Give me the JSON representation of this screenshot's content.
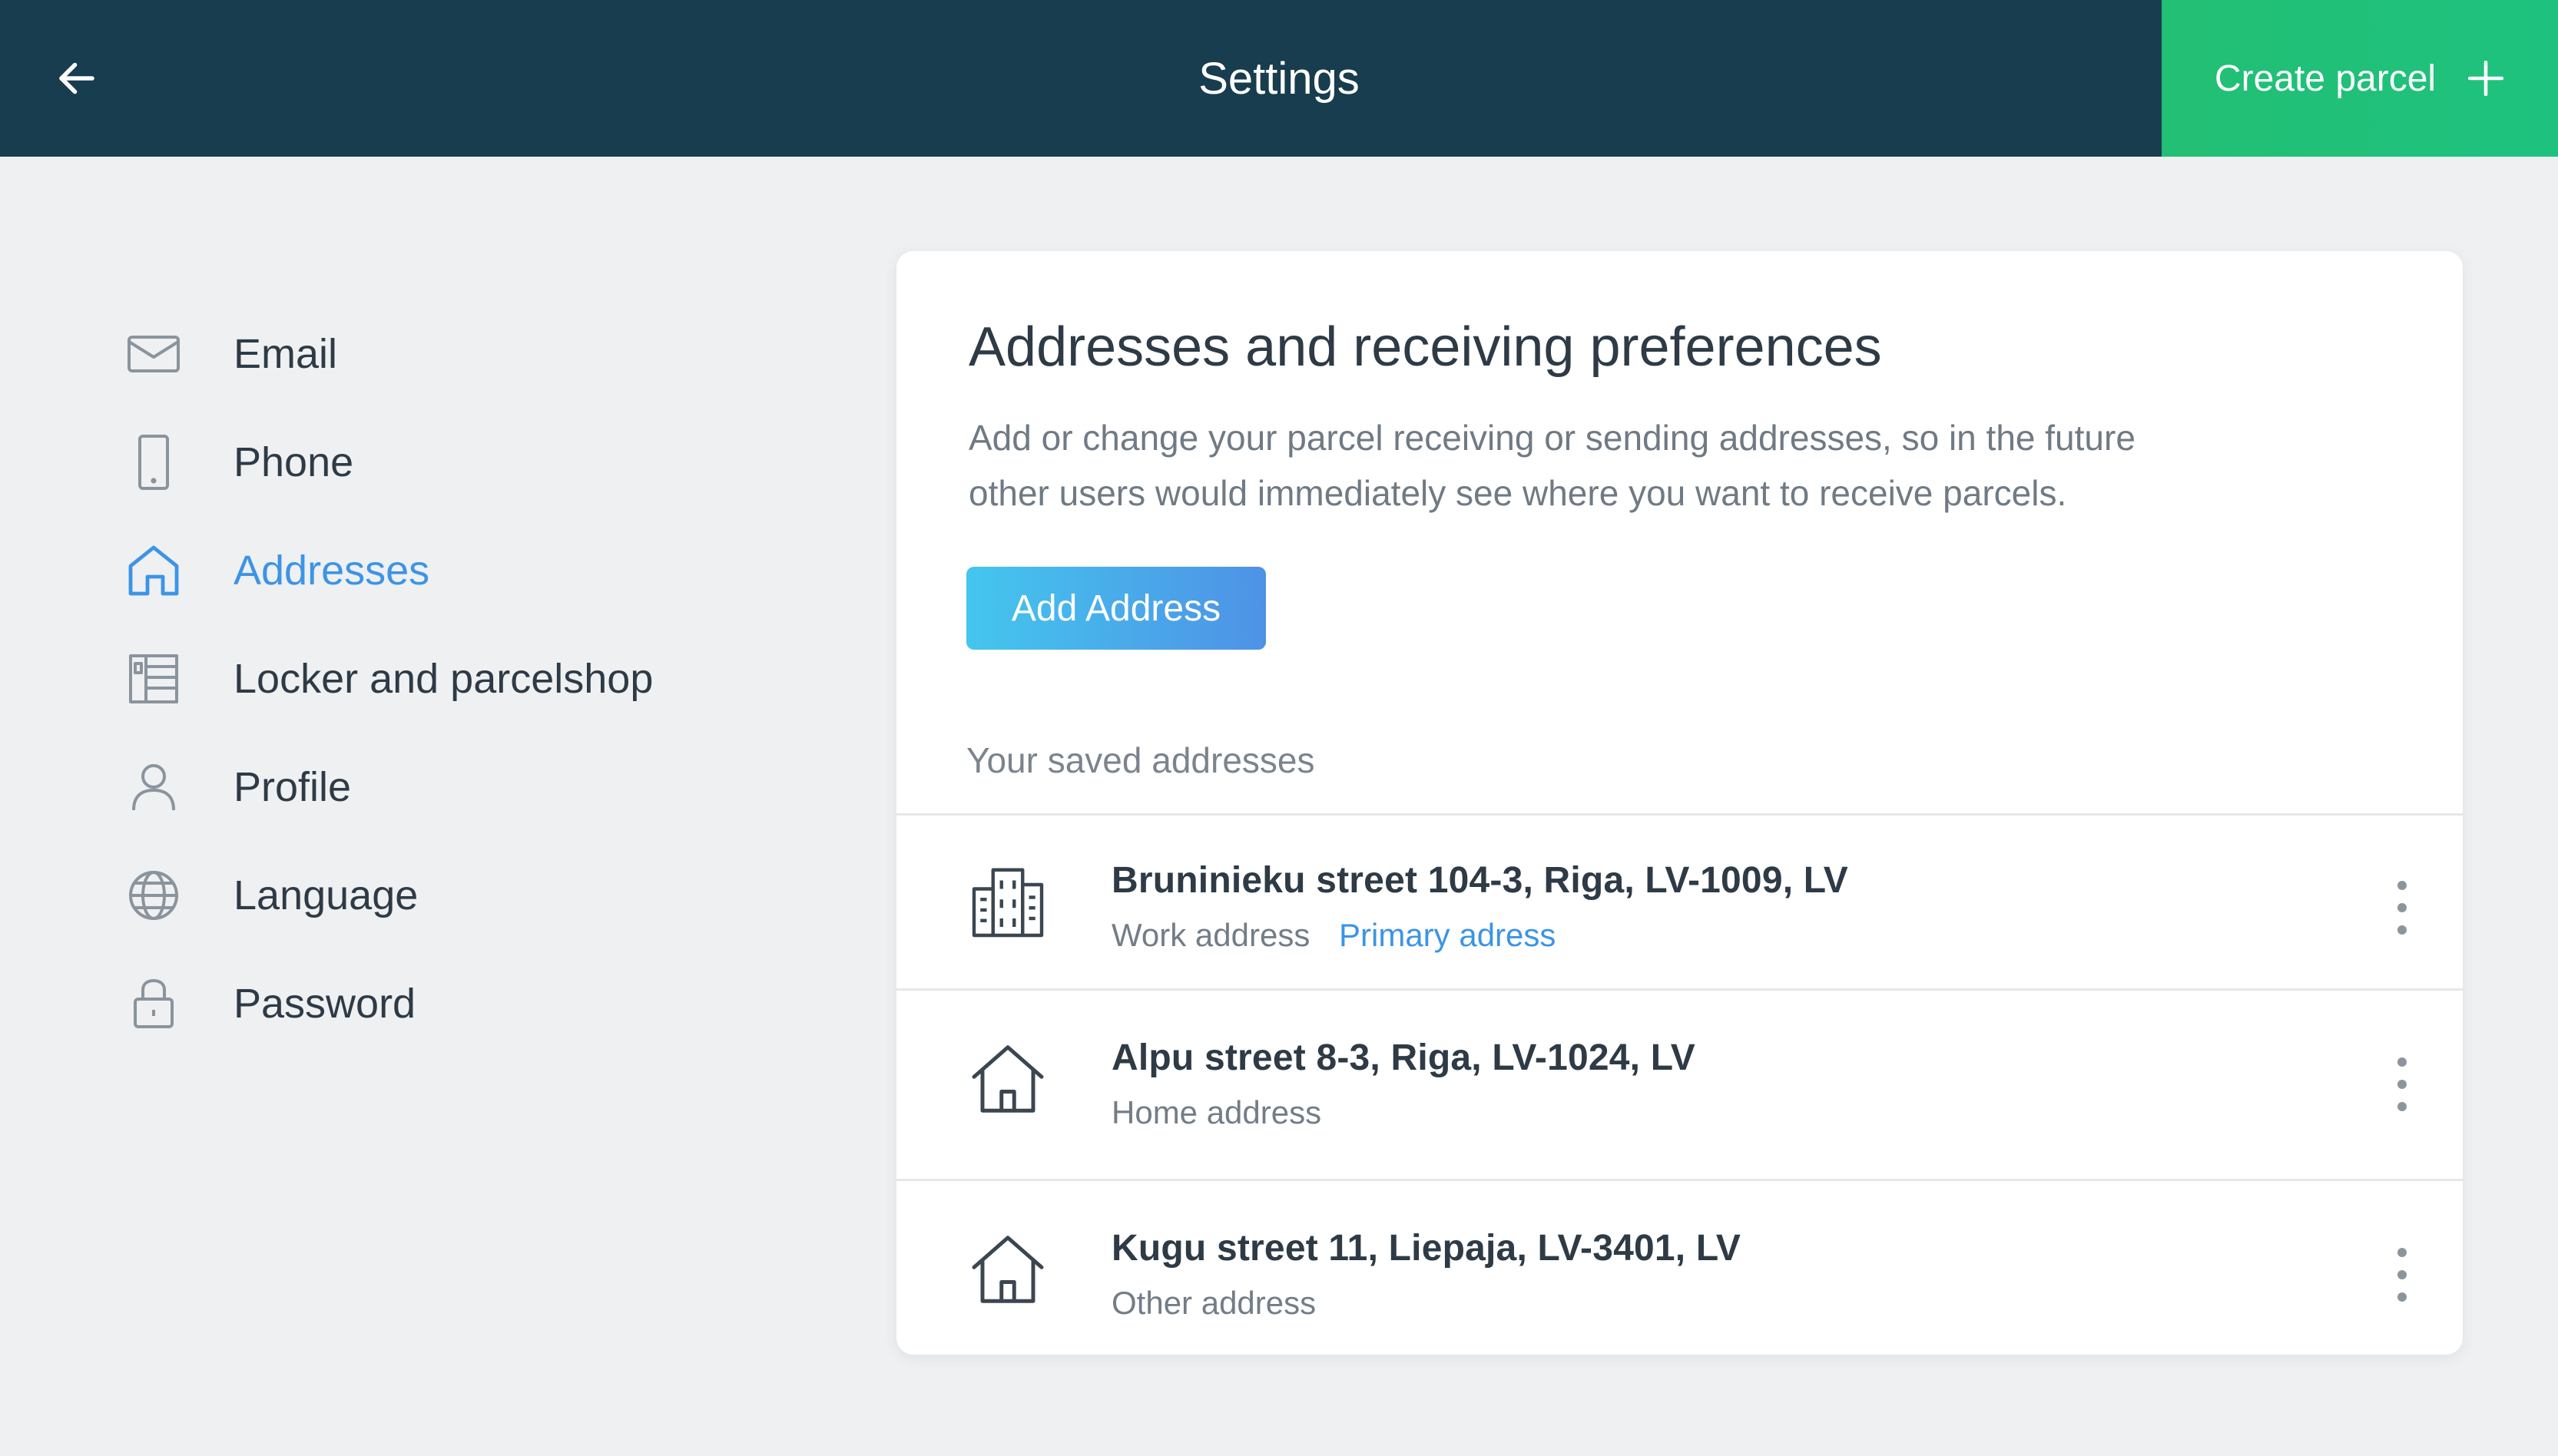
{
  "header": {
    "title": "Settings",
    "back_icon": "arrow-left-icon",
    "create_label": "Create parcel",
    "create_icon": "plus-icon"
  },
  "sidebar": {
    "items": [
      {
        "label": "Email",
        "icon": "envelope-icon",
        "active": false
      },
      {
        "label": "Phone",
        "icon": "phone-icon",
        "active": false
      },
      {
        "label": "Addresses",
        "icon": "house-icon",
        "active": true
      },
      {
        "label": "Locker and parcelshop",
        "icon": "locker-icon",
        "active": false
      },
      {
        "label": "Profile",
        "icon": "person-icon",
        "active": false
      },
      {
        "label": "Language",
        "icon": "globe-icon",
        "active": false
      },
      {
        "label": "Password",
        "icon": "lock-icon",
        "active": false
      }
    ]
  },
  "main": {
    "title": "Addresses and receiving preferences",
    "description_line1": "Add or change your parcel receiving or sending addresses, so in the future",
    "description_line2": "other users would immediately see where you want to receive parcels.",
    "add_button": "Add Address",
    "saved_label": "Your saved addresses",
    "addresses": [
      {
        "address": "Bruninieku street 104-3, Riga, LV-1009, LV",
        "type": "Work address",
        "primary": "Primary adress",
        "icon": "office-building-icon"
      },
      {
        "address": "Alpu street 8-3, Riga, LV-1024, LV",
        "type": "Home address",
        "primary": "",
        "icon": "house-icon"
      },
      {
        "address": "Kugu street 11, Liepaja, LV-3401, LV",
        "type": "Other address",
        "primary": "",
        "icon": "house-icon"
      }
    ]
  },
  "colors": {
    "header_bg": "#173d4e",
    "create_bg": "#22bf74",
    "accent_blue": "#3c94e6",
    "page_bg": "#eff0f2"
  }
}
